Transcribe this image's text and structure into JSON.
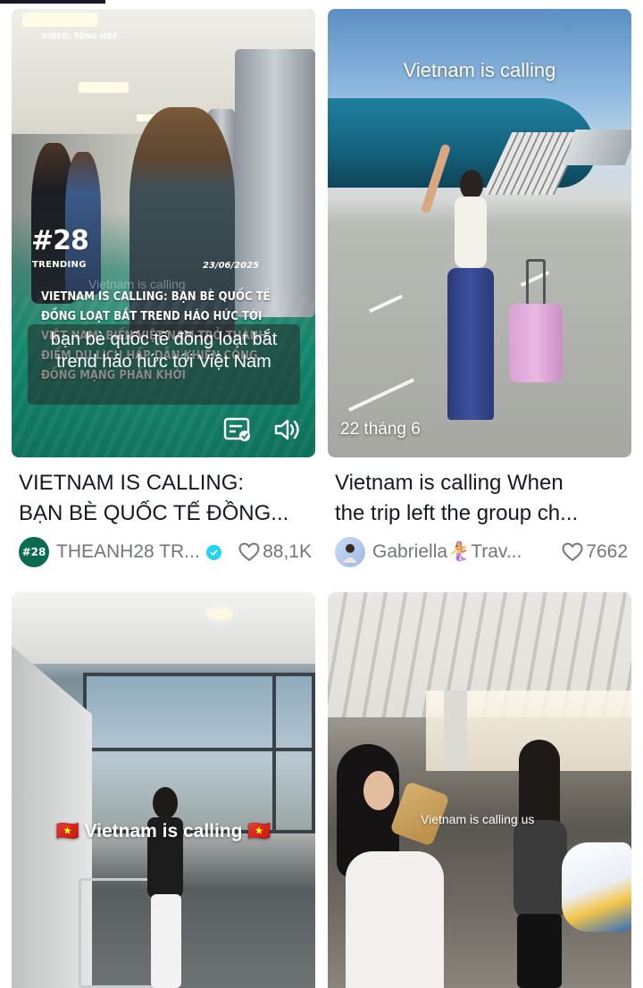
{
  "cards": [
    {
      "overlay": {
        "source_label": "VIDEO: TỔNG HỢP",
        "logo": "#28",
        "logo_sub": "TRENDING",
        "date": "23/06/2025",
        "faint_text": "Vietnam is calling",
        "headline": "VIETNAM IS CALLING: BẠN BÈ QUỐC TẾ ĐỒNG LOẠT BẮT TREND HÁO HỨC TỚI VIỆT NAM, BIẾN VIỆT NAM TRỞ THÀNH ĐIỂM DU LỊCH HẤP DẪN KHIẾN CỘNG ĐỒNG MẠNG PHẤN KHỞI",
        "caption": "bạn bè quốc tế đồng loạt bắt trend háo hức tới Việt Nam"
      },
      "title_line1": "VIETNAM IS CALLING:",
      "title_line2": "BẠN BÈ QUỐC TẾ ĐỒNG...",
      "author": "THEANH28 TR...",
      "avatar_text": "#28",
      "verified": true,
      "likes": "88,1K"
    },
    {
      "overlay": {
        "title": "Vietnam is calling",
        "date": "22 tháng 6"
      },
      "title_line1": "Vietnam is calling When",
      "title_line2": "the trip left the group ch...",
      "author": "Gabriella🧜‍♀️Trav...",
      "likes": "7662"
    },
    {
      "overlay": {
        "title": "Vietnam is calling",
        "flag": "🇻🇳"
      }
    },
    {
      "overlay": {
        "title": "Vietnam is calling us"
      }
    }
  ],
  "colors": {
    "text_primary": "#161823",
    "text_secondary": "#73757b",
    "verified": "#20d5ec",
    "overlay_green": "#08876a"
  },
  "icons": [
    "caption-icon",
    "sound-icon",
    "verified-icon",
    "heart-outline-icon"
  ]
}
